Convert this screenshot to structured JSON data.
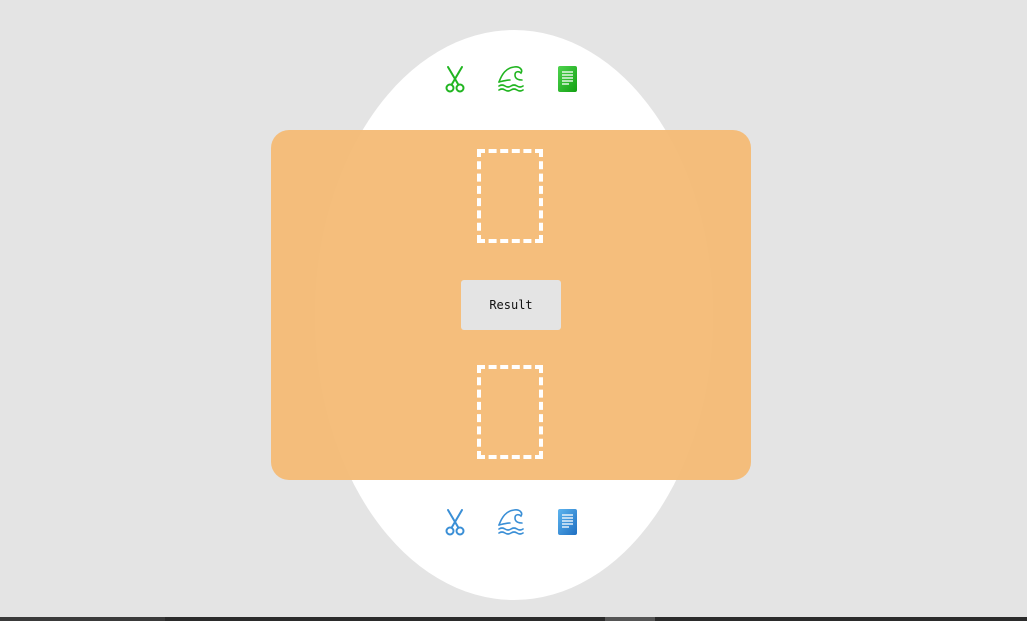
{
  "opponent": {
    "color": "#21b521",
    "icons": [
      "scissors-icon",
      "wave-icon",
      "paper-icon"
    ]
  },
  "player": {
    "color": "#3a8fd6",
    "icons": [
      "scissors-icon",
      "wave-icon",
      "paper-icon"
    ]
  },
  "board": {
    "color": "#f4bb75",
    "slot_border_color": "#ffffff"
  },
  "result_button": {
    "label": "Result"
  }
}
